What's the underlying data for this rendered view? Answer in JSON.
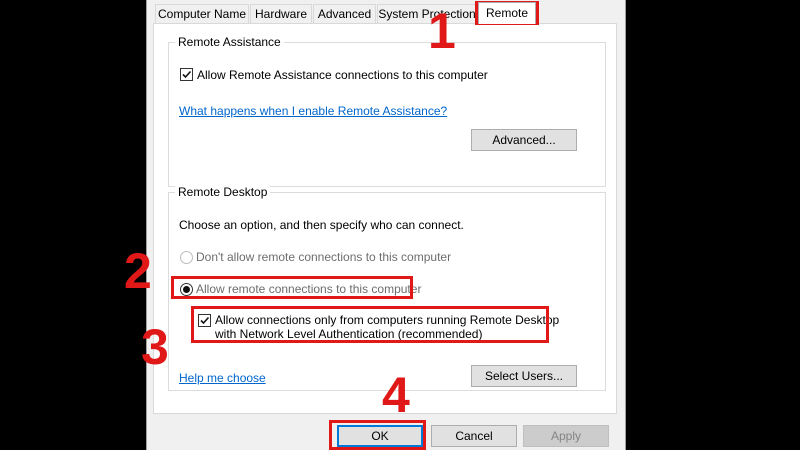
{
  "tabs": [
    {
      "label": "Computer Name",
      "active": false
    },
    {
      "label": "Hardware",
      "active": false
    },
    {
      "label": "Advanced",
      "active": false
    },
    {
      "label": "System Protection",
      "active": false
    },
    {
      "label": "Remote",
      "active": true
    }
  ],
  "remote_assistance": {
    "title": "Remote Assistance",
    "allow_label": "Allow Remote Assistance connections to this computer",
    "allow_checked": true,
    "help_link": "What happens when I enable Remote Assistance?",
    "advanced_button": "Advanced..."
  },
  "remote_desktop": {
    "title": "Remote Desktop",
    "instruction": "Choose an option, and then specify who can connect.",
    "option_disallow": "Don't allow remote connections to this computer",
    "option_allow": "Allow remote connections to this computer",
    "selected_option": "option_allow",
    "nla_label_line1": "Allow connections only from computers running Remote Desktop",
    "nla_label_line2": "with Network Level Authentication (recommended)",
    "nla_checked": true,
    "help_link": "Help me choose",
    "select_users_button": "Select Users..."
  },
  "footer": {
    "ok_button": "OK",
    "cancel_button": "Cancel",
    "apply_button": "Apply"
  },
  "annotations": {
    "step1": "1",
    "step2": "2",
    "step3": "3",
    "step4": "4",
    "highlight_color": "#e01818"
  },
  "colors": {
    "link": "#0066cc",
    "focus": "#0078d7",
    "background": "#000000",
    "dialog": "#f0f0f0"
  }
}
